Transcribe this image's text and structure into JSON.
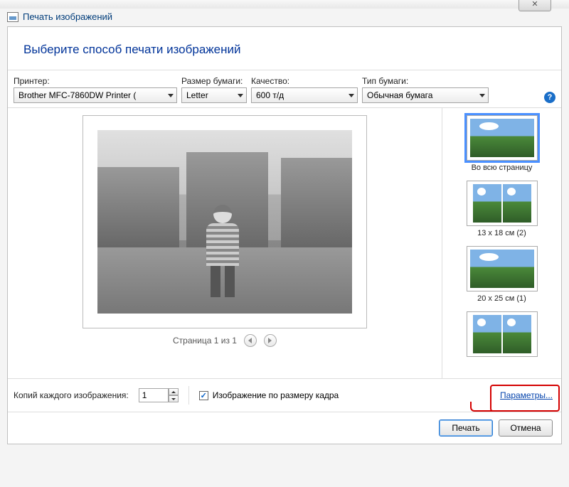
{
  "titlebar": {
    "close_glyph": "✕"
  },
  "header": {
    "title": "Печать изображений"
  },
  "instruction": "Выберите способ печати изображений",
  "controls": {
    "printer": {
      "label": "Принтер:",
      "value": "Brother MFC-7860DW Printer ("
    },
    "papersize": {
      "label": "Размер бумаги:",
      "value": "Letter"
    },
    "quality": {
      "label": "Качество:",
      "value": "600 т/д"
    },
    "papertype": {
      "label": "Тип бумаги:",
      "value": "Обычная бумага"
    }
  },
  "help_glyph": "?",
  "pager": {
    "text": "Страница 1 из 1"
  },
  "layouts": [
    {
      "label": "Во всю страницу",
      "selected": true,
      "cols": 1
    },
    {
      "label": "13 x 18 см (2)",
      "selected": false,
      "cols": 2
    },
    {
      "label": "20 x 25 см (1)",
      "selected": false,
      "cols": 1
    },
    {
      "label": "",
      "selected": false,
      "cols": 2
    }
  ],
  "bottom": {
    "copies_label": "Копий каждого изображения:",
    "copies_value": "1",
    "fit_label": "Изображение по размеру кадра",
    "fit_checked": true,
    "params_label": "Параметры..."
  },
  "actions": {
    "print": "Печать",
    "cancel": "Отмена"
  }
}
